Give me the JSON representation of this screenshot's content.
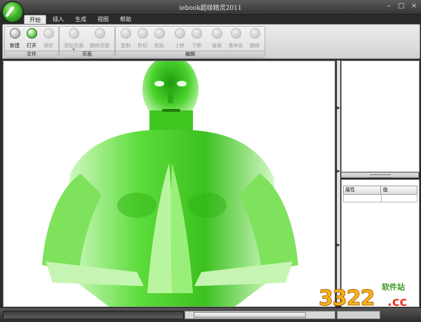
{
  "window": {
    "title": "iebook超级精灵2011"
  },
  "window_buttons": {
    "minimize": "–",
    "maximize": "□",
    "close": "×"
  },
  "tabs": [
    {
      "label": "开始",
      "active": true
    },
    {
      "label": "插入"
    },
    {
      "label": "生成"
    },
    {
      "label": "视图"
    },
    {
      "label": "帮助"
    }
  ],
  "ribbon": {
    "file_group": {
      "name": "文件",
      "buttons": [
        "新建",
        "打开",
        "保存"
      ]
    },
    "page_group": {
      "name": "页面",
      "buttons": [
        "添加页面",
        "删除页面"
      ]
    },
    "edit_group": {
      "name": "编辑",
      "buttons": [
        "复制",
        "剪切",
        "粘贴",
        "上移",
        "下移",
        "替换",
        "重命名",
        "删除"
      ]
    }
  },
  "properties": {
    "col_name": "属性",
    "col_value": "值"
  },
  "watermark": {
    "number": "3322",
    "domain": ".cc",
    "site_name": "软件站"
  },
  "colors": {
    "figure_green": "#3fd11f",
    "chrome_dark": "#353535",
    "ribbon_light": "#e6e6e6"
  }
}
